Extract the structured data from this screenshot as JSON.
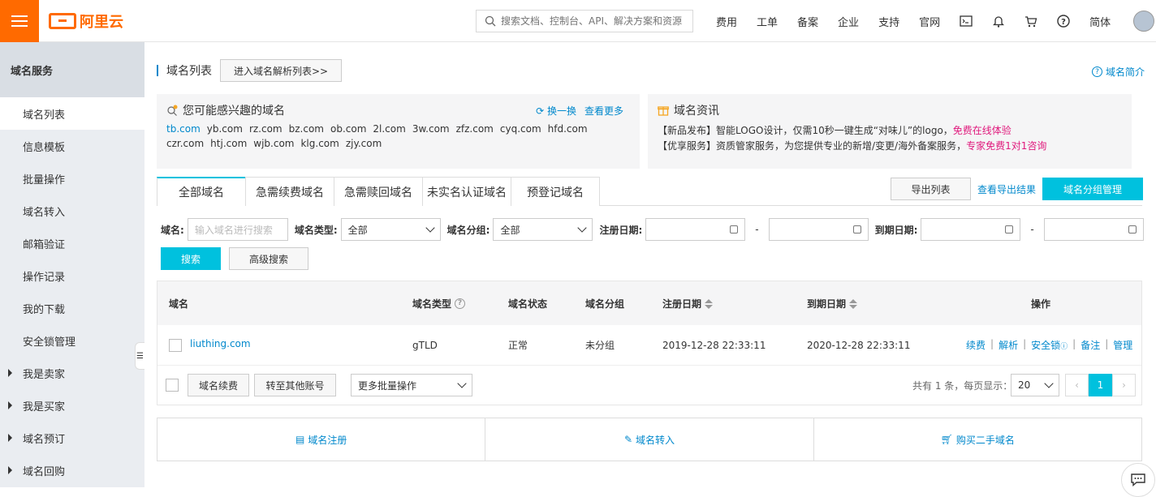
{
  "header": {
    "logo_text": "阿里云",
    "search_placeholder": "搜索文档、控制台、API、解决方案和资源",
    "nav": [
      "费用",
      "工单",
      "备案",
      "企业",
      "支持",
      "官网"
    ],
    "lang": "简体",
    "icons": [
      "terminal-icon",
      "bell-icon",
      "cart-icon",
      "help-icon"
    ]
  },
  "sidebar": {
    "title": "域名服务",
    "items": [
      {
        "label": "域名列表",
        "active": true
      },
      {
        "label": "信息模板"
      },
      {
        "label": "批量操作"
      },
      {
        "label": "域名转入"
      },
      {
        "label": "邮箱验证"
      },
      {
        "label": "操作记录"
      },
      {
        "label": "我的下载"
      },
      {
        "label": "安全锁管理"
      },
      {
        "label": "我是卖家",
        "expandable": true
      },
      {
        "label": "我是买家",
        "expandable": true
      },
      {
        "label": "域名预订",
        "expandable": true
      },
      {
        "label": "域名回购",
        "expandable": true
      }
    ]
  },
  "page": {
    "title": "域名列表",
    "goto_dns_button": "进入域名解析列表>>",
    "intro_link": "域名简介"
  },
  "suggest": {
    "title": "您可能感兴趣的域名",
    "refresh": "换一换",
    "more": "查看更多",
    "domains": [
      "tb.com",
      "yb.com",
      "rz.com",
      "bz.com",
      "ob.com",
      "2l.com",
      "3w.com",
      "zfz.com",
      "cyq.com",
      "hfd.com",
      "czr.com",
      "htj.com",
      "wjb.com",
      "klg.com",
      "zjy.com"
    ]
  },
  "news": {
    "title": "域名资讯",
    "line1_prefix": "【新品发布】智能LOGO设计，仅需10秒一键生成“对味儿”的logo，",
    "line1_link": "免费在线体验",
    "line2_prefix": "【优享服务】资质管家服务，为您提供专业的新增/变更/海外备案服务，",
    "line2_link": "专家免费1对1咨询"
  },
  "tabs": [
    "全部域名",
    "急需续费域名",
    "急需赎回域名",
    "未实名认证域名",
    "预登记域名"
  ],
  "tab_actions": {
    "export": "导出列表",
    "view_export": "查看导出结果",
    "group_manage": "域名分组管理"
  },
  "filters": {
    "domain_label": "域名:",
    "domain_placeholder": "输入域名进行搜索",
    "type_label": "域名类型:",
    "type_value": "全部",
    "group_label": "域名分组:",
    "group_value": "全部",
    "reg_date_label": "注册日期:",
    "exp_date_label": "到期日期:",
    "dash": "-",
    "search_btn": "搜索",
    "advanced_btn": "高级搜索"
  },
  "table": {
    "headers": {
      "domain": "域名",
      "type": "域名类型",
      "status": "域名状态",
      "group": "域名分组",
      "reg_date": "注册日期",
      "exp_date": "到期日期",
      "ops": "操作"
    },
    "rows": [
      {
        "domain": "liuthing.com",
        "type": "gTLD",
        "status": "正常",
        "group": "未分组",
        "reg_date": "2019-12-28 22:33:11",
        "exp_date": "2020-12-28 22:33:11",
        "ops": [
          "续费",
          "解析",
          "安全锁",
          "备注",
          "管理"
        ]
      }
    ],
    "footer": {
      "renew_btn": "域名续费",
      "transfer_btn": "转至其他账号",
      "batch_select": "更多批量操作",
      "total_text": "共有 1 条，每页显示：",
      "page_size": "20",
      "current_page": "1"
    }
  },
  "bottom_actions": [
    "域名注册",
    "域名转入",
    "购买二手域名"
  ],
  "colors": {
    "brand": "#ff6a00",
    "primary": "#00c1de",
    "link": "#0088cc",
    "highlight": "#e0187c"
  }
}
